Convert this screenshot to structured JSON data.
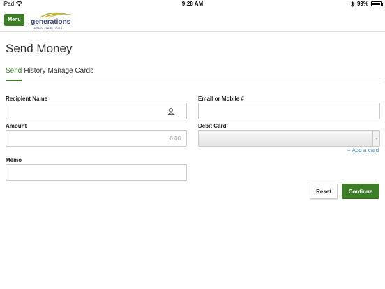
{
  "statusbar": {
    "device": "iPad",
    "time": "9:28 AM",
    "battery": "99%"
  },
  "header": {
    "menu_label": "Menu",
    "logo_word": "generations",
    "logo_sub": "federal credit union"
  },
  "page": {
    "title": "Send Money"
  },
  "tabs": [
    {
      "label": "Send",
      "active": true
    },
    {
      "label": "History",
      "active": false
    },
    {
      "label": "Manage Cards",
      "active": false
    }
  ],
  "form": {
    "recipient_label": "Recipient Name",
    "recipient_value": "",
    "amount_label": "Amount",
    "amount_placeholder": "0.00",
    "memo_label": "Memo",
    "memo_value": "",
    "email_label": "Email or Mobile #",
    "email_value": "",
    "debit_label": "Debit Card",
    "debit_value": "",
    "add_card_label": "+ Add a card"
  },
  "actions": {
    "reset_label": "Reset",
    "continue_label": "Continue"
  },
  "colors": {
    "brand_green": "#3e7d27",
    "brand_navy": "#3a4a7a",
    "link_blue": "#4a8fc1"
  }
}
